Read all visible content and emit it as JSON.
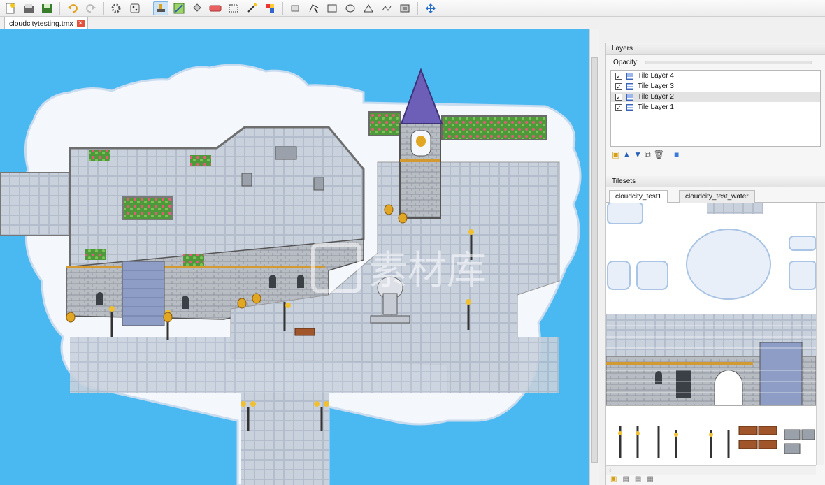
{
  "document": {
    "tab_label": "cloudcitytesting.tmx"
  },
  "toolbar": {
    "icons": [
      "new-icon",
      "open-icon",
      "save-icon",
      "undo-icon",
      "redo-icon",
      "commands-icon",
      "random-icon",
      "stamp-icon",
      "terrain-brush-icon",
      "bucket-fill-icon",
      "eraser-icon",
      "rect-select-icon",
      "magic-wand-icon",
      "select-same-tile-icon",
      "select-objects-icon",
      "edit-polygons-icon",
      "insert-rectangle-icon",
      "insert-ellipse-icon",
      "insert-polygon-icon",
      "insert-polyline-icon",
      "insert-tile-icon",
      "move-icon"
    ]
  },
  "layers": {
    "title": "Layers",
    "opacity_label": "Opacity:",
    "items": [
      {
        "label": "Tile Layer 4",
        "checked": true,
        "selected": false
      },
      {
        "label": "Tile Layer 3",
        "checked": true,
        "selected": false
      },
      {
        "label": "Tile Layer 2",
        "checked": true,
        "selected": true
      },
      {
        "label": "Tile Layer 1",
        "checked": true,
        "selected": false
      }
    ]
  },
  "tilesets": {
    "title": "Tilesets",
    "tabs": [
      {
        "label": "cloudcity_test1",
        "active": true
      },
      {
        "label": "cloudcity_test_water",
        "active": false
      }
    ]
  },
  "watermark": {
    "text": "素材库"
  },
  "colors": {
    "sky": "#4ab9f2",
    "cloud": "#f4f7fb",
    "floor": "#c8d0dc",
    "wall": "#b9bcc2",
    "roof": "#6d5fb8"
  }
}
